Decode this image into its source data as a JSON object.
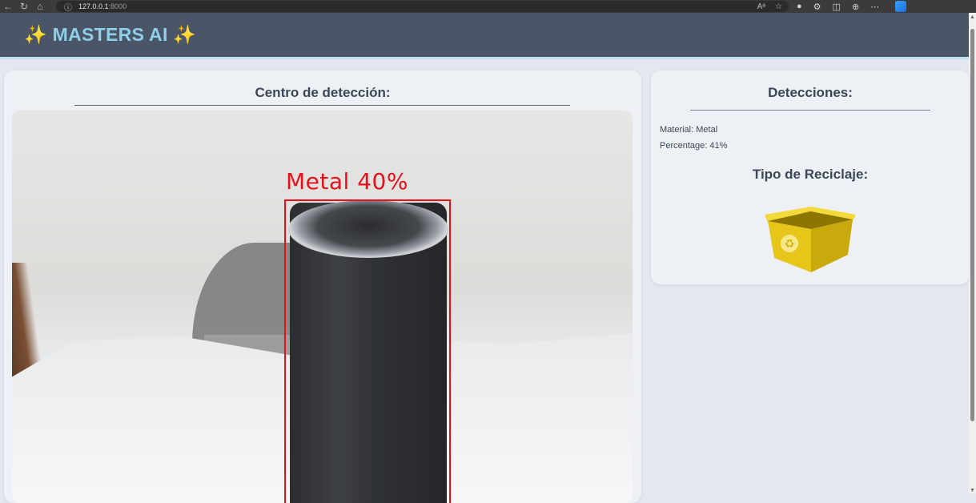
{
  "browser": {
    "url": "127.0.0.1",
    "url_port": ":8000"
  },
  "header": {
    "title": "MASTERS AI",
    "sparkle": "✨"
  },
  "detection_center": {
    "heading": "Centro de detección:",
    "box_label": "Metal 40%"
  },
  "detections": {
    "heading": "Detecciones:",
    "material_label": "Material:",
    "material_value": "Metal",
    "percentage_label": "Percentage:",
    "percentage_value": "41%",
    "recycle_heading": "Tipo de Reciclaje:"
  },
  "icons": {
    "recycle_bin": "yellow-recycle-bin-icon"
  },
  "colors": {
    "header_bg": "#4a5568",
    "title": "#8fd0e8",
    "box": "#e8101a",
    "bin": "#e6c619"
  }
}
